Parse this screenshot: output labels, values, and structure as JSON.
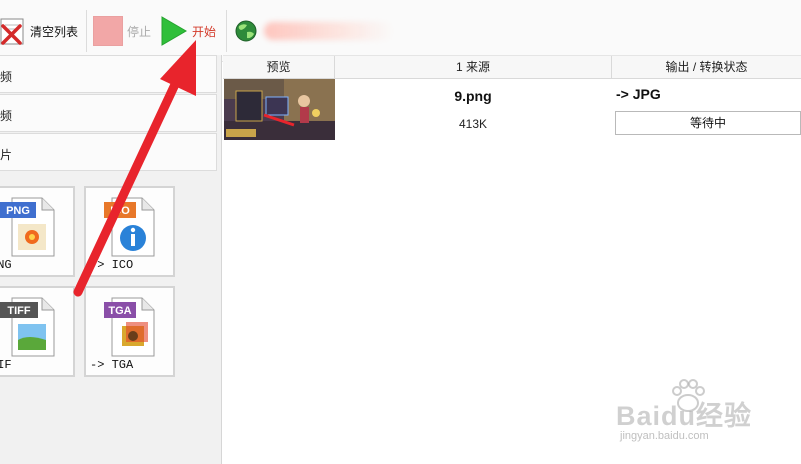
{
  "toolbar": {
    "clear_label": "清空列表",
    "stop_label": "停止",
    "start_label": "开始"
  },
  "left_panel": {
    "categories": [
      {
        "label": "频"
      },
      {
        "label": "频"
      },
      {
        "label": "片"
      }
    ],
    "format_tiles": [
      {
        "badge": "PNG",
        "label": "PNG",
        "badge_color": "#3f6fcf"
      },
      {
        "badge": "ICO",
        "label": "-> ICO",
        "badge_color": "#e8782a"
      },
      {
        "badge": "TIFF",
        "label": "TIF",
        "badge_color": "#555555"
      },
      {
        "badge": "TGA",
        "label": "-> TGA",
        "badge_color": "#8a4fa8"
      }
    ]
  },
  "file_list": {
    "columns": [
      "预览",
      "1 来源",
      "输出 / 转换状态"
    ],
    "rows": [
      {
        "name": "9.png",
        "size": "413K",
        "target": "-> JPG",
        "status": "等待中"
      }
    ]
  },
  "watermark": {
    "logo": "Baidu经验",
    "url": "jingyan.baidu.com"
  },
  "colors": {
    "accent_red": "#e8242c",
    "start_green": "#2fbf3a",
    "stop_pink": "#f2a7a7"
  },
  "icons": [
    "clear-list-icon",
    "stop-icon",
    "play-icon",
    "globe-icon",
    "annotation-arrow"
  ]
}
